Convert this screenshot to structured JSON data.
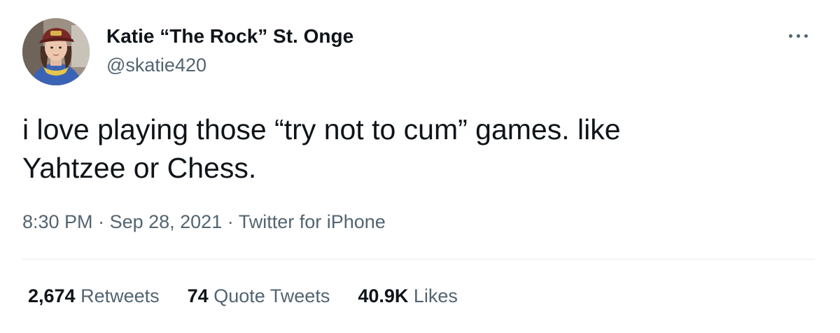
{
  "author": {
    "display_name": "Katie “The Rock” St. Onge",
    "handle": "@skatie420"
  },
  "tweet": {
    "text": "i love playing those “try not to cum” games. like\nYahtzee or Chess.",
    "time": "8:30 PM",
    "separator": " · ",
    "date": "Sep 28, 2021",
    "source": "Twitter for iPhone"
  },
  "stats": {
    "retweets_count": "2,674",
    "retweets_label": "Retweets",
    "quotes_count": "74",
    "quotes_label": "Quote Tweets",
    "likes_count": "40.9K",
    "likes_label": "Likes"
  },
  "icons": {
    "more": "more-horizontal-icon"
  },
  "colors": {
    "text_primary": "#0f1419",
    "text_secondary": "#536471",
    "divider": "#e6ecf0"
  }
}
